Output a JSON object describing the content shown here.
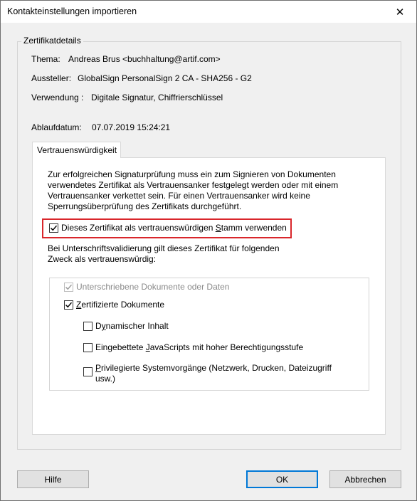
{
  "window": {
    "title": "Kontakteinstellungen importieren",
    "close_glyph": "✕"
  },
  "details": {
    "legend": "Zertifikatdetails",
    "thema_label": "Thema:",
    "thema_value": "Andreas Brus <buchhaltung@artif.com>",
    "aussteller_label": "Aussteller:",
    "aussteller_value": "GlobalSign PersonalSign 2 CA - SHA256 - G2",
    "verwendung_label": "Verwendung :",
    "verwendung_value": "Digitale Signatur, Chiffrierschlüssel",
    "ablauf_label": "Ablaufdatum:",
    "ablauf_value": "07.07.2019 15:24:21"
  },
  "tab": {
    "label": "Vertrauenswürdigkeit"
  },
  "trust": {
    "description": [
      "Zur erfolgreichen Signaturprüfung muss ein zum Signieren von Dokumenten",
      "verwendetes Zertifikat als Vertrauensanker festgelegt werden oder mit einem",
      "Vertrauensanker verkettet sein. Für einen Vertrauensanker wird keine",
      "Sperrungsüberprüfung des Zertifikats durchgeführt."
    ],
    "root_checkbox": {
      "prefix": "Dieses Zertifikat als vertrauenswürdigen ",
      "accel": "S",
      "suffix": "tamm verwenden",
      "checked": true
    },
    "purpose_text": [
      "Bei Unterschriftsvalidierung gilt dieses Zertifikat für folgenden",
      "Zweck als vertrauenswürdig:"
    ],
    "options": {
      "signed_docs": {
        "label": "Unterschriebene Dokumente oder Daten",
        "checked": true,
        "disabled": true
      },
      "certified_docs": {
        "accel": "Z",
        "rest": "ertifizierte Dokumente",
        "checked": true
      },
      "dynamic": {
        "prefix": "D",
        "accel": "y",
        "rest": "namischer Inhalt",
        "checked": false
      },
      "javascripts": {
        "prefix": "Eingebettete ",
        "accel": "J",
        "rest": "avaScripts mit hoher Berechtigungsstufe",
        "checked": false
      },
      "privileged": {
        "accel": "P",
        "line1_rest": "rivilegierte Systemvorgänge (Netzwerk, Drucken, Dateizugriff",
        "line2": "usw.)",
        "checked": false
      }
    }
  },
  "buttons": {
    "help": "Hilfe",
    "ok": "OK",
    "cancel": "Abbrechen"
  }
}
